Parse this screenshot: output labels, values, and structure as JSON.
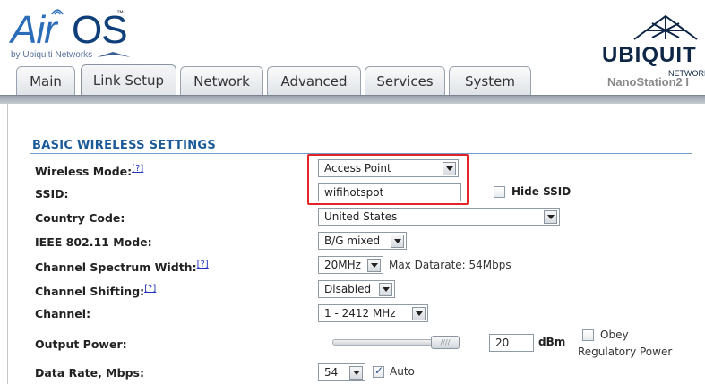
{
  "header": {
    "logo_air": "Air",
    "logo_os": "OS",
    "logo_tm": "™",
    "logo_subtitle": "by Ubiquiti Networks",
    "brand_name": "UBIQUIT",
    "brand_subtitle": "NETWORK",
    "device_name": "NanoStation2 I"
  },
  "tabs": [
    {
      "label": "Main",
      "active": false
    },
    {
      "label": "Link Setup",
      "active": true
    },
    {
      "label": "Network",
      "active": false
    },
    {
      "label": "Advanced",
      "active": false
    },
    {
      "label": "Services",
      "active": false
    },
    {
      "label": "System",
      "active": false
    }
  ],
  "section": {
    "title": "BASIC WIRELESS SETTINGS"
  },
  "help_link": "[?]",
  "form": {
    "wireless_mode": {
      "label": "Wireless Mode:",
      "value": "Access Point"
    },
    "ssid": {
      "label": "SSID:",
      "value": "wifihotspot",
      "hide_label": "Hide SSID",
      "hide_checked": false
    },
    "country_code": {
      "label": "Country Code:",
      "value": "United States"
    },
    "ieee_mode": {
      "label": "IEEE 802.11 Mode:",
      "value": "B/G mixed"
    },
    "channel_width": {
      "label": "Channel Spectrum Width:",
      "value": "20MHz",
      "max_datarate": "Max Datarate: 54Mbps"
    },
    "channel_shifting": {
      "label": "Channel Shifting:",
      "value": "Disabled"
    },
    "channel": {
      "label": "Channel:",
      "value": "1 - 2412 MHz"
    },
    "output_power": {
      "label": "Output Power:",
      "value": "20",
      "unit": "dBm",
      "obey_label_1": "Obey",
      "obey_label_2": "Regulatory Power",
      "obey_checked": false,
      "slider_level": 0.9
    },
    "data_rate": {
      "label": "Data Rate, Mbps:",
      "value": "54",
      "auto_label": "Auto",
      "auto_checked": true
    }
  },
  "colors": {
    "accent_blue": "#1b5a98",
    "highlight_red": "#e0242a",
    "brand_dark": "#0f2746"
  }
}
